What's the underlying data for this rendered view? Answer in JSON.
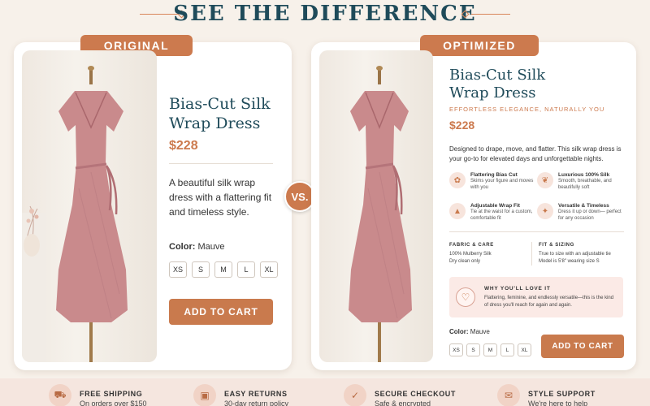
{
  "header": {
    "title": "SEE THE DIFFERENCE"
  },
  "vs_label": "VS.",
  "original": {
    "badge": "ORIGINAL",
    "title": "Bias-Cut Silk Wrap Dress",
    "price": "$228",
    "description": "A beautiful silk wrap dress with a flattering fit and timeless style.",
    "color_label": "Color:",
    "color_value": "Mauve",
    "sizes": [
      "XS",
      "S",
      "M",
      "L",
      "XL"
    ],
    "cta": "ADD TO CART"
  },
  "optimized": {
    "badge": "OPTIMIZED",
    "title": "Bias-Cut Silk Wrap Dress",
    "tagline": "EFFORTLESS ELEGANCE, NATURALLY YOU",
    "price": "$228",
    "description": "Designed to drape, move, and flatter. This silk wrap dress is your go-to for elevated days and unforgettable nights.",
    "features": [
      {
        "icon": "leaf-icon",
        "title": "Flattering Bias Cut",
        "desc": "Skims your figure and moves with you"
      },
      {
        "icon": "feather-icon",
        "title": "Luxurious 100% Silk",
        "desc": "Smooth, breathable, and beautifully soft"
      },
      {
        "icon": "dress-icon",
        "title": "Adjustable Wrap Fit",
        "desc": "Tie at the waist for a custom, comfortable fit"
      },
      {
        "icon": "sparkle-icon",
        "title": "Versatile & Timeless",
        "desc": "Dress it up or down— perfect for any occasion"
      }
    ],
    "fabric": {
      "heading": "FABRIC & CARE",
      "line1": "100% Mulberry Silk",
      "line2": "Dry clean only"
    },
    "fit": {
      "heading": "FIT & SIZING",
      "line1": "True to size with an adjustable tie",
      "line2": "Model is 5'8\" wearing size S"
    },
    "love": {
      "heading": "WHY YOU'LL LOVE IT",
      "text": "Flattering, feminine, and endlessly versatile—this is the kind of dress you'll reach for again and again."
    },
    "color_label": "Color:",
    "color_value": "Mauve",
    "sizes": [
      "XS",
      "S",
      "M",
      "L",
      "XL"
    ],
    "cta": "ADD TO CART"
  },
  "footer": [
    {
      "icon": "truck-icon",
      "title": "FREE SHIPPING",
      "desc": "On orders over $150"
    },
    {
      "icon": "box-icon",
      "title": "EASY RETURNS",
      "desc": "30-day return policy"
    },
    {
      "icon": "shield-icon",
      "title": "SECURE CHECKOUT",
      "desc": "Safe & encrypted"
    },
    {
      "icon": "chat-icon",
      "title": "STYLE SUPPORT",
      "desc": "We're here to help"
    }
  ],
  "colors": {
    "accent": "#cc7a4e",
    "heading": "#1f4b5a",
    "dress": "#c98a8c",
    "footer_bg": "#f5e6df"
  }
}
